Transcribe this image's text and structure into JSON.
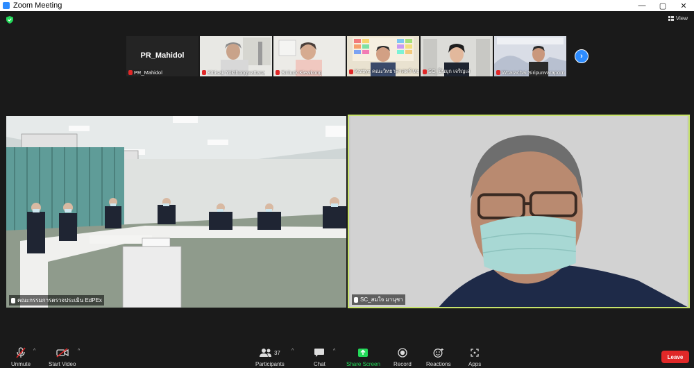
{
  "window": {
    "title": "Zoom Meeting",
    "controls": [
      "—",
      "▢",
      "✕"
    ]
  },
  "top_bar": {
    "view_label": "View"
  },
  "filmstrip": {
    "thumbnails": [
      {
        "name": "PR_Mahidol",
        "display_text": "PR_Mahidol",
        "muted": true
      },
      {
        "name": "Kittisak Yokthongwattana",
        "muted": true
      },
      {
        "name": "Siriluck Kiewkong",
        "muted": true
      },
      {
        "name": "Kattiya คณะวิทยาศาสตร์ Mahidol Science",
        "muted": true
      },
      {
        "name": "SC_ปิ่นมุก เจริญเส",
        "muted": true
      },
      {
        "name": "Woarachai Siripunvaraporn",
        "muted": true
      }
    ],
    "next_icon": "chevron-right-icon"
  },
  "main_videos": [
    {
      "name": "คณะกรรมการตรวจประเมิน EdPEx",
      "muted": false
    },
    {
      "name": "SC_สมใจ มานุชา",
      "muted": false,
      "active_speaker": true
    }
  ],
  "toolbar": {
    "unmute": "Unmute",
    "start_video": "Start Video",
    "participants": "Participants",
    "participants_count": "37",
    "chat": "Chat",
    "share_screen": "Share Screen",
    "record": "Record",
    "reactions": "Reactions",
    "apps": "Apps",
    "leave": "Leave"
  },
  "colors": {
    "accent": "#2d8cff",
    "active_border": "#c7e36a",
    "share_green": "#23d959",
    "leave_red": "#e02828"
  }
}
